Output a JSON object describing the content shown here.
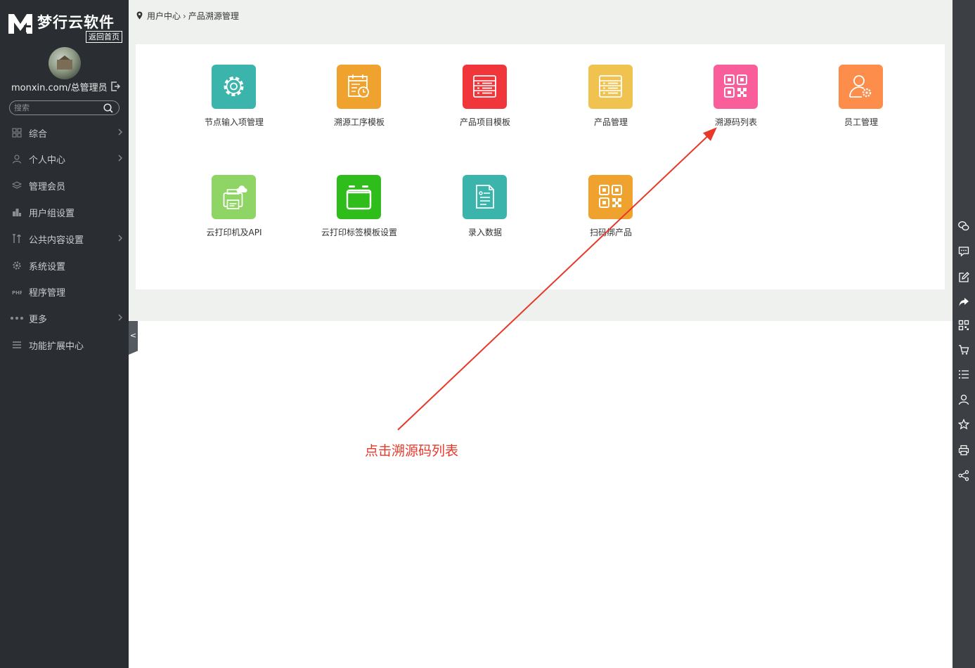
{
  "brand": {
    "name": "梦行云软件",
    "home_link": "返回首页"
  },
  "user": {
    "label": "monxin.com/总管理员"
  },
  "search": {
    "placeholder": "搜索"
  },
  "sidebar": {
    "items": [
      {
        "label": "综合",
        "icon": "grid-icon",
        "has_submenu": true
      },
      {
        "label": "个人中心",
        "icon": "user-icon",
        "has_submenu": true
      },
      {
        "label": "管理会员",
        "icon": "layers-icon",
        "has_submenu": false
      },
      {
        "label": "用户组设置",
        "icon": "buildings-icon",
        "has_submenu": false
      },
      {
        "label": "公共内容设置",
        "icon": "tools-icon",
        "has_submenu": true
      },
      {
        "label": "系统设置",
        "icon": "gear-icon",
        "has_submenu": false
      },
      {
        "label": "程序管理",
        "icon": "php-icon",
        "has_submenu": false
      },
      {
        "label": "更多",
        "icon": "dots-icon",
        "has_submenu": true
      },
      {
        "label": "功能扩展中心",
        "icon": "menu-icon",
        "has_submenu": false
      }
    ],
    "collapse_glyph": "<"
  },
  "breadcrumb": {
    "items": [
      "用户中心",
      "产品溯源管理"
    ],
    "separator": "›"
  },
  "tiles": [
    {
      "label": "节点输入项管理",
      "icon": "gear-icon",
      "color": "#3bb4ab"
    },
    {
      "label": "溯源工序模板",
      "icon": "calendar-clock-icon",
      "color": "#f0a22e"
    },
    {
      "label": "产品项目模板",
      "icon": "list-icon",
      "color": "#f0363a"
    },
    {
      "label": "产品管理",
      "icon": "list-icon",
      "color": "#f0c350"
    },
    {
      "label": "溯源码列表",
      "icon": "qrcode-icon",
      "color": "#f95e9b"
    },
    {
      "label": "员工管理",
      "icon": "user-gear-icon",
      "color": "#fc8d4a"
    },
    {
      "label": "云打印机及API",
      "icon": "cloud-printer-icon",
      "color": "#8fd565"
    },
    {
      "label": "云打印标签模板设置",
      "icon": "label-template-icon",
      "color": "#2ebd1a"
    },
    {
      "label": "录入数据",
      "icon": "document-icon",
      "color": "#3bb4ab"
    },
    {
      "label": "扫码绑产品",
      "icon": "qrcode-icon",
      "color": "#f0a22e"
    }
  ],
  "annotation": {
    "text": "点击溯源码列表",
    "color": "#e8382a"
  },
  "rightbar": {
    "icons": [
      "wechat-icon",
      "comment-icon",
      "edit-icon",
      "share-arrow-icon",
      "qrcode-icon",
      "cart-icon",
      "list-icon",
      "user-icon",
      "star-icon",
      "print-icon",
      "share-icon"
    ]
  }
}
